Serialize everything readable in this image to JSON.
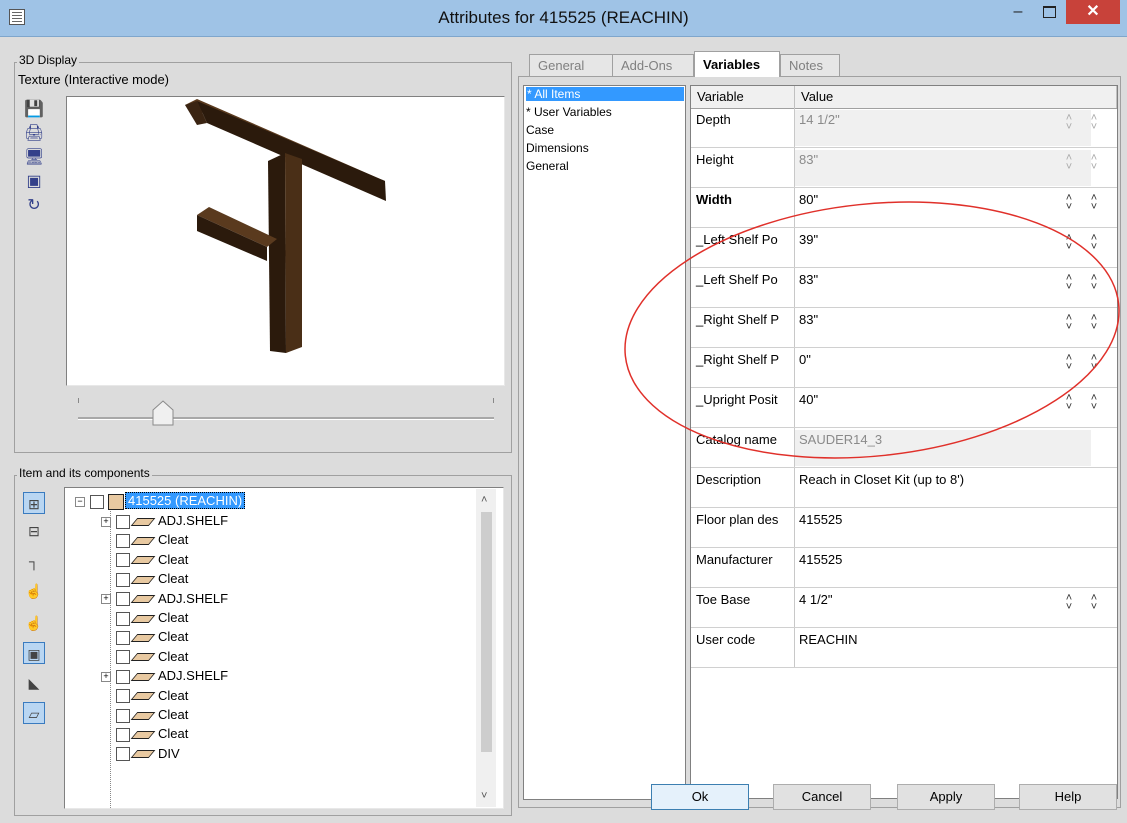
{
  "window": {
    "title": "Attributes for 415525 (REACHIN)",
    "min": "–",
    "close": "✕"
  },
  "display": {
    "group_label": "3D Display",
    "mode_label": "Texture (Interactive mode)",
    "tools": [
      "save-icon",
      "print-icon",
      "monitor-icon",
      "monitor-window-icon",
      "refresh-icon"
    ],
    "tool_glyphs": [
      "💾",
      "🖨",
      "🖥",
      "▣",
      "↻"
    ]
  },
  "tree": {
    "group_label": "Item and its components",
    "root": "415525 (REACHIN)",
    "items": [
      "ADJ.SHELF",
      "Cleat",
      "Cleat",
      "Cleat",
      "ADJ.SHELF",
      "Cleat",
      "Cleat",
      "Cleat",
      "ADJ.SHELF",
      "Cleat",
      "Cleat",
      "Cleat",
      "DIV"
    ],
    "expandable": [
      true,
      false,
      false,
      false,
      true,
      false,
      false,
      false,
      true,
      false,
      false,
      false,
      false
    ],
    "tools": [
      "expand-all-icon",
      "collapse-all-icon",
      "hierarchy-icon",
      "hand-cursor-icon",
      "hand-icon",
      "box-view-icon",
      "corner-view-icon",
      "shelf-view-icon"
    ],
    "tool_glyphs": [
      "⊞",
      "⊟",
      "┐",
      "☝",
      "☝",
      "▣",
      "◣",
      "▱"
    ],
    "selected_tools": [
      0,
      5,
      7
    ]
  },
  "tabs": [
    "General",
    "Add-Ons",
    "Variables",
    "Notes"
  ],
  "active_tab": 2,
  "categories": [
    "* All Items",
    "* User Variables",
    "Case",
    "Dimensions",
    "General"
  ],
  "grid": {
    "col_variable": "Variable",
    "col_value": "Value",
    "rows": [
      {
        "name": "Depth",
        "value": "14 1/2\"",
        "disabled": true,
        "spin": true,
        "bold": false
      },
      {
        "name": "Height",
        "value": "83\"",
        "disabled": true,
        "spin": true,
        "bold": false
      },
      {
        "name": "Width",
        "value": "80\"",
        "disabled": false,
        "spin": true,
        "bold": true
      },
      {
        "name": "_Left Shelf Po",
        "value": "39\"",
        "disabled": false,
        "spin": true,
        "bold": false
      },
      {
        "name": "_Left Shelf Po",
        "value": "83\"",
        "disabled": false,
        "spin": true,
        "bold": false
      },
      {
        "name": "_Right Shelf P",
        "value": "83\"",
        "disabled": false,
        "spin": true,
        "bold": false
      },
      {
        "name": "_Right Shelf P",
        "value": "0\"",
        "disabled": false,
        "spin": true,
        "bold": false
      },
      {
        "name": "_Upright Posit",
        "value": "40\"",
        "disabled": false,
        "spin": true,
        "bold": false
      },
      {
        "name": "Catalog name",
        "value": "SAUDER14_3",
        "disabled": true,
        "spin": false,
        "bold": false
      },
      {
        "name": "Description",
        "value": "Reach in Closet Kit (up to 8')",
        "disabled": false,
        "spin": false,
        "bold": false
      },
      {
        "name": "Floor plan des",
        "value": "415525",
        "disabled": false,
        "spin": false,
        "bold": false
      },
      {
        "name": "Manufacturer",
        "value": "415525",
        "disabled": false,
        "spin": false,
        "bold": false
      },
      {
        "name": "Toe Base",
        "value": "4 1/2\"",
        "disabled": false,
        "spin": true,
        "bold": false
      },
      {
        "name": "User code",
        "value": "REACHIN",
        "disabled": false,
        "spin": false,
        "bold": false
      }
    ]
  },
  "buttons": {
    "ok": "Ok",
    "cancel": "Cancel",
    "apply": "Apply",
    "help": "Help"
  },
  "colors": {
    "title_bar": "#9fc3e6",
    "close": "#c8423a",
    "selection": "#3399ff",
    "annotation": "#e0302a",
    "wood": "#3a2412"
  }
}
